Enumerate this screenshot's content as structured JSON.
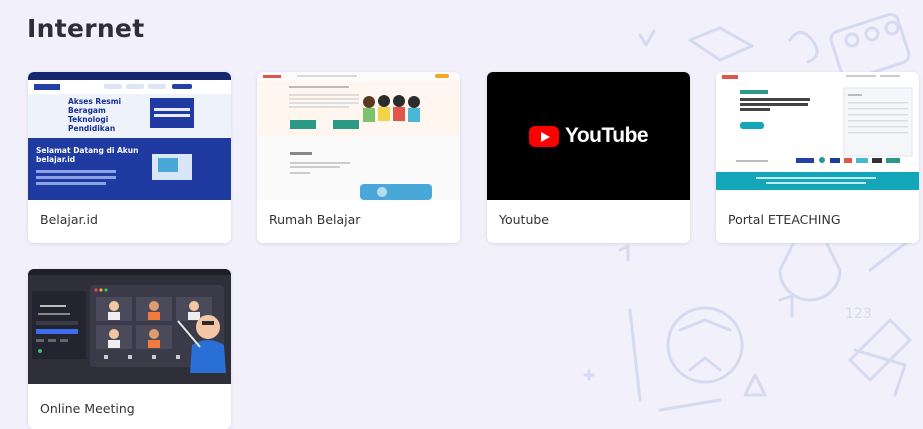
{
  "section": {
    "title": "Internet"
  },
  "cards": [
    {
      "label": "Belajar.id",
      "thumb": {
        "hero_title": "Akses Resmi Beragam Teknologi Pendidikan",
        "welcome_title": "Selamat Datang di Akun belajar.id"
      }
    },
    {
      "label": "Rumah Belajar",
      "thumb": {}
    },
    {
      "label": "Youtube",
      "thumb": {
        "logo_text": "YouTube"
      }
    },
    {
      "label": "Portal ETEACHING",
      "thumb": {}
    },
    {
      "label": "Online Meeting",
      "thumb": {}
    }
  ],
  "colors": {
    "belajar_navy": "#1f3aa0",
    "belajar_top": "#15286e",
    "rumah_green": "#2a9a87",
    "eteaching_teal": "#13a6b8",
    "youtube_red": "#ff0000",
    "meeting_dark": "#2f2f3a",
    "page_bg": "#f1f0fb"
  }
}
